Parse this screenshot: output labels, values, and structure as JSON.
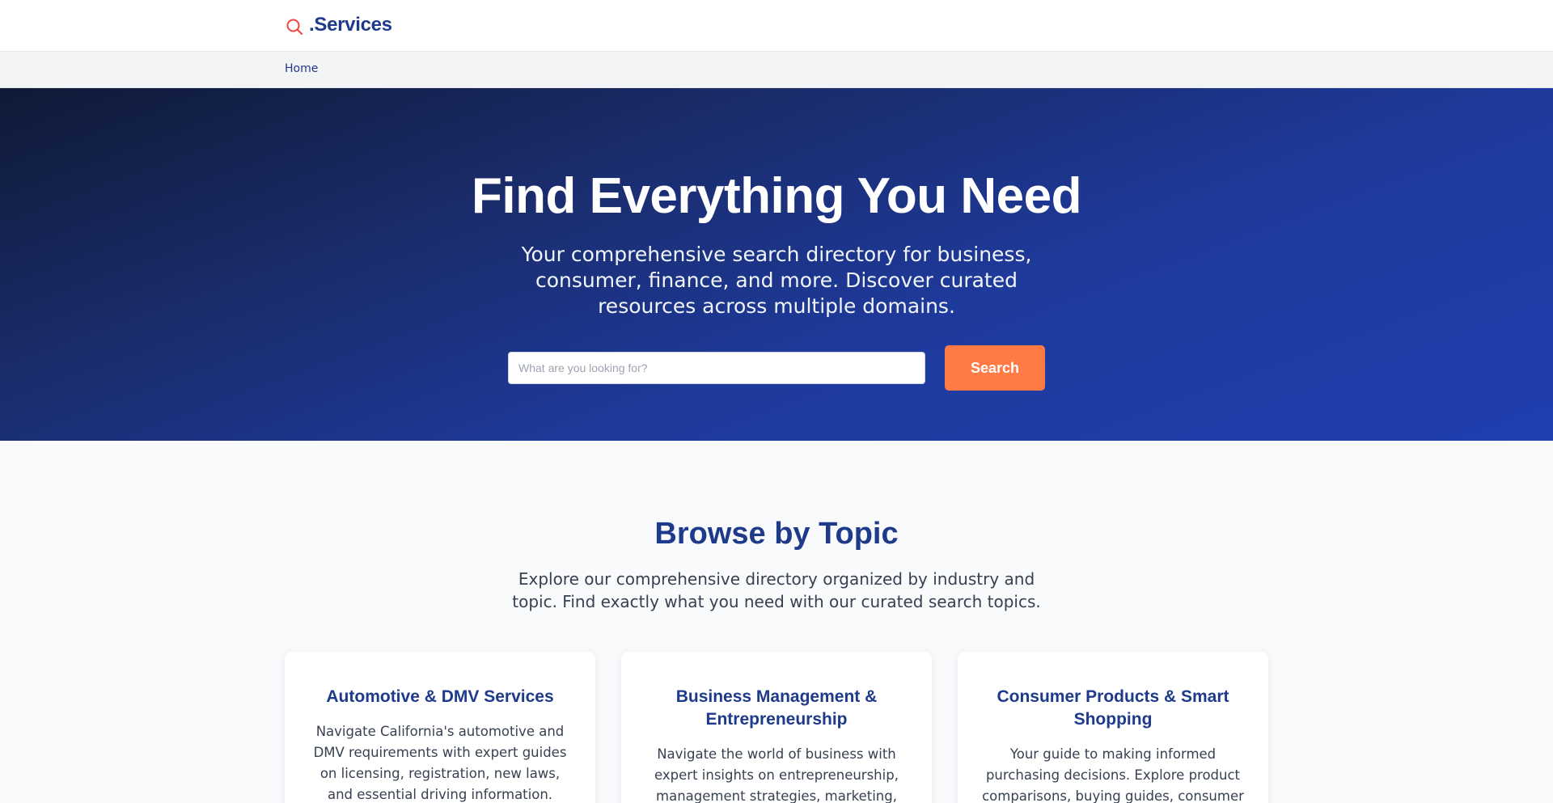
{
  "header": {
    "logo_text": ".Services",
    "logo_icon": "search-icon"
  },
  "breadcrumb": {
    "home": "Home"
  },
  "hero": {
    "title": "Find Everything You Need",
    "subtitle": "Your comprehensive search directory for business, consumer, finance, and more. Discover curated resources across multiple domains.",
    "search_placeholder": "What are you looking for?",
    "search_button": "Search"
  },
  "topics": {
    "title": "Browse by Topic",
    "lead": "Explore our comprehensive directory organized by industry and topic. Find exactly what you need with our curated search topics.",
    "cards": [
      {
        "title": "Automotive & DMV Services",
        "description": "Navigate California's automotive and DMV requirements with expert guides on licensing, registration, new laws, and essential driving information."
      },
      {
        "title": "Business Management & Entrepreneurship",
        "description": "Navigate the world of business with expert insights on entrepreneurship, management strategies, marketing, operations, and"
      },
      {
        "title": "Consumer Products & Smart Shopping",
        "description": "Your guide to making informed purchasing decisions. Explore product comparisons, buying guides, consumer trends, and tips for"
      }
    ]
  },
  "colors": {
    "brand": "#1e3a8a",
    "accent": "#ff7a45",
    "logo_icon": "#ef4444"
  }
}
